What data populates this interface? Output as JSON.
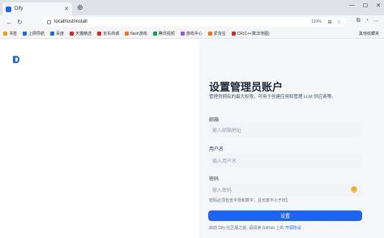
{
  "browser": {
    "tab_title": "Dify",
    "tab_close": "✕",
    "new_tab": "⊕",
    "window_controls": [
      "—",
      "☐",
      "✕"
    ],
    "url": "localhost/install",
    "zoom": "110%",
    "nav": {
      "back": "←",
      "reload": "↻"
    }
  },
  "bookmarks": {
    "items": [
      {
        "label": "书签",
        "color": "#f59e0b"
      },
      {
        "label": "上网导航",
        "color": "#1c64f2"
      },
      {
        "label": "百度",
        "color": "#2563eb"
      },
      {
        "label": "天猫精选",
        "color": "#dc2626"
      },
      {
        "label": "京东商城",
        "color": "#dc2626"
      },
      {
        "label": "flash游戏",
        "color": "#f97316"
      },
      {
        "label": "腾讯视频",
        "color": "#16a34a"
      },
      {
        "label": "游戏中心",
        "color": "#8b5cf6"
      },
      {
        "label": "爱淘宝",
        "color": "#f97316"
      },
      {
        "label": "CR(C++算法地图)",
        "color": "#dc2626"
      }
    ],
    "right_label": "其他收藏夹"
  },
  "page": {
    "title": "设置管理员账户",
    "subtitle": "管理员拥有的最大权限，可用于创建应用和管理 LLM 供应商等。",
    "email_label": "邮箱",
    "email_placeholder": "输入邮箱地址",
    "username_label": "用户名",
    "username_placeholder": "输入用户名",
    "password_label": "密码",
    "password_placeholder": "输入密码",
    "password_hint": "密码必须包含字母和数字，且长度不小于8位",
    "submit_label": "设置",
    "footer_text": "启动 Dify 社区版之前, 请阅读 GitHub 上的 ",
    "footer_link": "开源协议"
  },
  "colors": {
    "accent": "#1c64f2",
    "panel_bg": "#f5f7fa"
  }
}
